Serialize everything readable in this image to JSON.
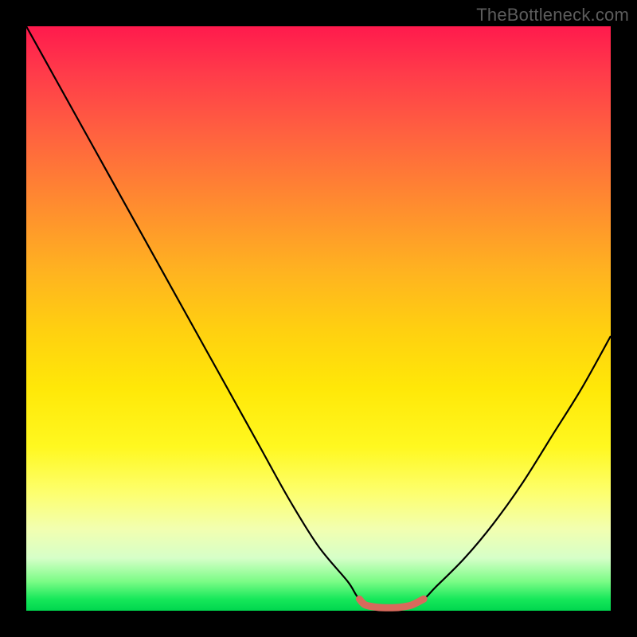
{
  "watermark": "TheBottleneck.com",
  "chart_data": {
    "type": "line",
    "title": "",
    "xlabel": "",
    "ylabel": "",
    "xlim": [
      0,
      100
    ],
    "ylim": [
      0,
      100
    ],
    "series": [
      {
        "name": "bottleneck-curve",
        "x": [
          0,
          5,
          10,
          15,
          20,
          25,
          30,
          35,
          40,
          45,
          50,
          55,
          57,
          60,
          65,
          68,
          70,
          75,
          80,
          85,
          90,
          95,
          100
        ],
        "values": [
          100,
          91,
          82,
          73,
          64,
          55,
          46,
          37,
          28,
          19,
          11,
          5,
          2,
          0.5,
          0.5,
          2,
          4,
          9,
          15,
          22,
          30,
          38,
          47
        ]
      },
      {
        "name": "sweet-spot-marker",
        "x": [
          57,
          58,
          60,
          62,
          64,
          66,
          68
        ],
        "values": [
          2.0,
          1.0,
          0.6,
          0.5,
          0.6,
          1.0,
          2.0
        ]
      }
    ],
    "colors": {
      "curve": "#000000",
      "marker": "#d86a5c",
      "gradient_top": "#ff1a4d",
      "gradient_bottom": "#00d64e"
    }
  }
}
